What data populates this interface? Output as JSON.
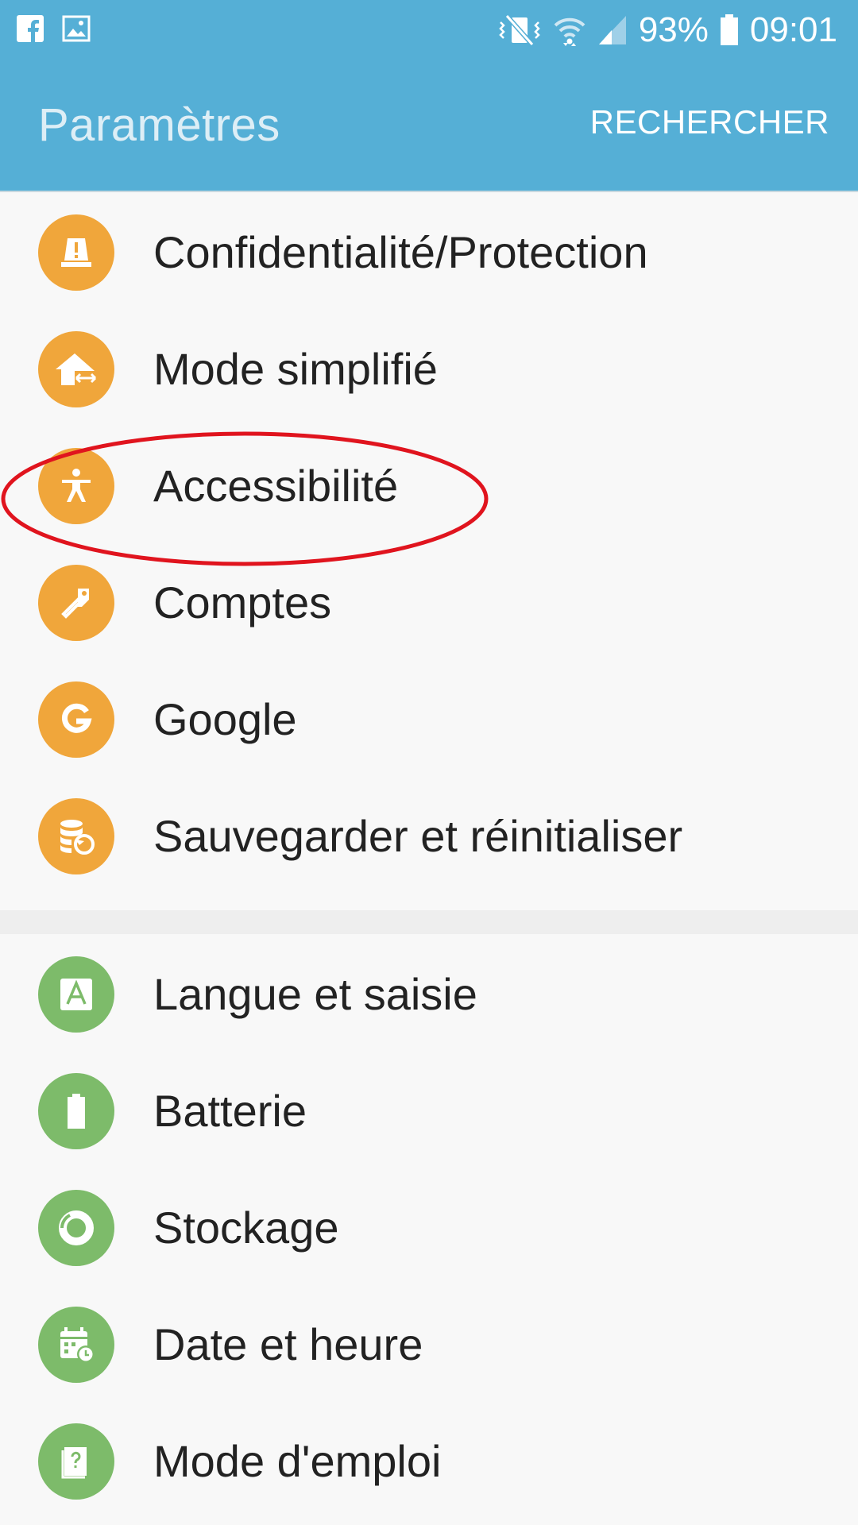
{
  "status_bar": {
    "left_icons": [
      "facebook-icon",
      "image-icon"
    ],
    "right_icons": [
      "vibrate-mute-icon",
      "wifi-icon",
      "signal-icon",
      "battery-icon"
    ],
    "battery_percent": "93%",
    "time": "09:01"
  },
  "header": {
    "title": "Paramètres",
    "search_label": "RECHERCHER"
  },
  "groups": [
    {
      "icon_color": "#f0a63b",
      "items": [
        {
          "label": "Confidentialité/Protection",
          "icon": "alert-light-icon"
        },
        {
          "label": "Mode simplifié",
          "icon": "easy-mode-home-icon"
        },
        {
          "label": "Accessibilité",
          "icon": "accessibility-person-icon",
          "highlighted": true
        },
        {
          "label": "Comptes",
          "icon": "key-icon"
        },
        {
          "label": "Google",
          "icon": "google-g-icon"
        },
        {
          "label": "Sauvegarder et réinitialiser",
          "icon": "backup-restore-icon"
        }
      ]
    },
    {
      "icon_color": "#7dbb6a",
      "items": [
        {
          "label": "Langue et saisie",
          "icon": "language-a-icon"
        },
        {
          "label": "Batterie",
          "icon": "battery-icon"
        },
        {
          "label": "Stockage",
          "icon": "storage-pie-icon"
        },
        {
          "label": "Date et heure",
          "icon": "calendar-clock-icon"
        },
        {
          "label": "Mode d'emploi",
          "icon": "user-manual-icon"
        }
      ]
    }
  ],
  "annotation": {
    "shape": "ellipse",
    "color": "#e0141e",
    "target": "Accessibilité"
  }
}
